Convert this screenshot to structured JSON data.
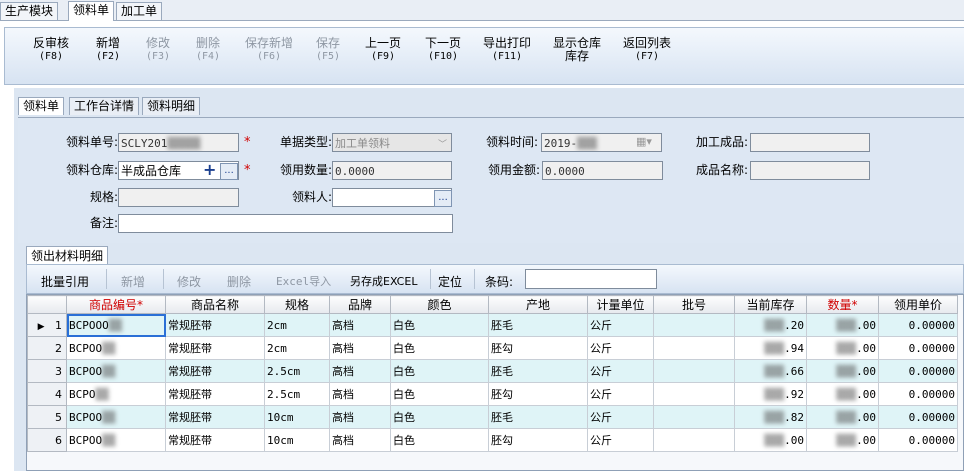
{
  "module_tabs": [
    "生产模块",
    "领料单",
    "加工单"
  ],
  "active_module_tab": 1,
  "toolbar": [
    {
      "label": "反审核",
      "key": "(F8)",
      "enabled": true
    },
    {
      "label": "新增",
      "key": "(F2)",
      "enabled": true
    },
    {
      "label": "修改",
      "key": "(F3)",
      "enabled": false
    },
    {
      "label": "删除",
      "key": "(F4)",
      "enabled": false
    },
    {
      "label": "保存新增",
      "key": "(F6)",
      "enabled": false
    },
    {
      "label": "保存",
      "key": "(F5)",
      "enabled": false
    },
    {
      "label": "上一页",
      "key": "(F9)",
      "enabled": true
    },
    {
      "label": "下一页",
      "key": "(F10)",
      "enabled": true
    },
    {
      "label": "导出打印",
      "key": "(F11)",
      "enabled": true
    },
    {
      "label": "显示仓库",
      "key": "库存",
      "enabled": true
    },
    {
      "label": "返回列表",
      "key": "(F7)",
      "enabled": true
    }
  ],
  "sub_tabs": [
    "领料单",
    "工作台详情",
    "领料明细"
  ],
  "form": {
    "order_no_label": "领料单号:",
    "order_no_value": "SCLY201",
    "warehouse_label": "领料仓库:",
    "warehouse_value": "半成品仓库",
    "spec_label": "规格:",
    "remark_label": "备注:",
    "doc_type_label": "单据类型:",
    "doc_type_value": "加工单领料",
    "qty_label": "领用数量:",
    "qty_value": "0.0000",
    "picker_label": "领料人:",
    "time_label": "领料时间:",
    "time_value": "2019-",
    "amount_label": "领用金额:",
    "amount_value": "0.0000",
    "product_label": "加工成品:",
    "product_name_label": "成品名称:",
    "required_mark": "*",
    "plus_glyph": "+",
    "ellipsis_glyph": "..."
  },
  "detail": {
    "tab_label": "领出材料明细",
    "tools": [
      {
        "label": "批量引用",
        "enabled": true
      },
      {
        "label": "新增",
        "enabled": false
      },
      {
        "label": "修改",
        "enabled": false
      },
      {
        "label": "删除",
        "enabled": false
      },
      {
        "label": "Excel导入",
        "enabled": false
      },
      {
        "label": "另存成EXCEL",
        "enabled": true
      },
      {
        "label": "定位",
        "enabled": true
      }
    ],
    "barcode_label": "条码:",
    "barcode_value": ""
  },
  "grid": {
    "columns": [
      "",
      "商品编号*",
      "商品名称",
      "规格",
      "品牌",
      "颜色",
      "产地",
      "计量单位",
      "批号",
      "当前库存",
      "数量*",
      "领用单价"
    ],
    "required_columns": [
      1,
      10
    ],
    "rows": [
      {
        "idx": "1",
        "code": "BCPOOO",
        "name": "常规胚带",
        "spec": "2cm",
        "brand": "高档",
        "color": "白色",
        "origin": "胚毛",
        "unit": "公斤",
        "batch": "",
        "stock": ".20",
        "qty": ".00",
        "price": "0.00000"
      },
      {
        "idx": "2",
        "code": "BCPOO",
        "name": "常规胚带",
        "spec": "2cm",
        "brand": "高档",
        "color": "白色",
        "origin": "胚勾",
        "unit": "公斤",
        "batch": "",
        "stock": ".94",
        "qty": ".00",
        "price": "0.00000"
      },
      {
        "idx": "3",
        "code": "BCPOO",
        "name": "常规胚带",
        "spec": "2.5cm",
        "brand": "高档",
        "color": "白色",
        "origin": "胚毛",
        "unit": "公斤",
        "batch": "",
        "stock": ".66",
        "qty": ".00",
        "price": "0.00000"
      },
      {
        "idx": "4",
        "code": "BCPO",
        "name": "常规胚带",
        "spec": "2.5cm",
        "brand": "高档",
        "color": "白色",
        "origin": "胚勾",
        "unit": "公斤",
        "batch": "",
        "stock": ".92",
        "qty": ".00",
        "price": "0.00000"
      },
      {
        "idx": "5",
        "code": "BCPOO",
        "name": "常规胚带",
        "spec": "10cm",
        "brand": "高档",
        "color": "白色",
        "origin": "胚毛",
        "unit": "公斤",
        "batch": "",
        "stock": ".82",
        "qty": ".00",
        "price": "0.00000"
      },
      {
        "idx": "6",
        "code": "BCPOO",
        "name": "常规胚带",
        "spec": "10cm",
        "brand": "高档",
        "color": "白色",
        "origin": "胚勾",
        "unit": "公斤",
        "batch": "",
        "stock": ".00",
        "qty": ".00",
        "price": "0.00000"
      }
    ],
    "current_row_glyph": "▶"
  },
  "colors": {
    "accent": "#2a6fd6",
    "required": "#d00000",
    "row_alt": "#dff4f7"
  }
}
